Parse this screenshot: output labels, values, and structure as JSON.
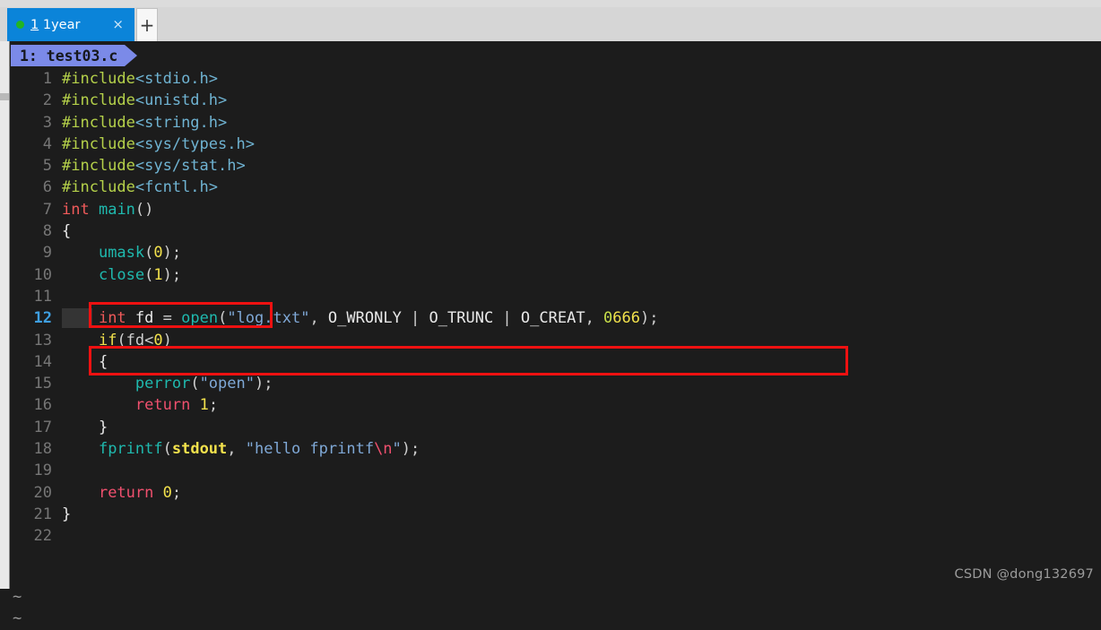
{
  "tabbar": {
    "tab": {
      "index_label": "1",
      "title": " 1year",
      "close_label": "×",
      "dot_color": "#22b522",
      "active_color": "#0b84d9"
    },
    "new_tab_label": "+"
  },
  "editor": {
    "filetab": {
      "label": "1: test03.c",
      "background": "#7b8ae8"
    },
    "current_line": 12,
    "tilde_markers": [
      "~",
      "~"
    ],
    "lines": [
      {
        "n": "1",
        "tokens": [
          {
            "t": "#include",
            "c": "t-pre"
          },
          {
            "t": "<stdio.h>",
            "c": "t-hdr"
          }
        ]
      },
      {
        "n": "2",
        "tokens": [
          {
            "t": "#include",
            "c": "t-pre"
          },
          {
            "t": "<unistd.h>",
            "c": "t-hdr"
          }
        ]
      },
      {
        "n": "3",
        "tokens": [
          {
            "t": "#include",
            "c": "t-pre"
          },
          {
            "t": "<string.h>",
            "c": "t-hdr"
          }
        ]
      },
      {
        "n": "4",
        "tokens": [
          {
            "t": "#include",
            "c": "t-pre"
          },
          {
            "t": "<sys/types.h>",
            "c": "t-hdr"
          }
        ]
      },
      {
        "n": "5",
        "tokens": [
          {
            "t": "#include",
            "c": "t-pre"
          },
          {
            "t": "<sys/stat.h>",
            "c": "t-hdr"
          }
        ]
      },
      {
        "n": "6",
        "tokens": [
          {
            "t": "#include",
            "c": "t-pre"
          },
          {
            "t": "<fcntl.h>",
            "c": "t-hdr"
          }
        ]
      },
      {
        "n": "7",
        "tokens": [
          {
            "t": "int",
            "c": "t-type"
          },
          {
            "t": " ",
            "c": "t-plain"
          },
          {
            "t": "main",
            "c": "t-fn"
          },
          {
            "t": "()",
            "c": "t-punct"
          }
        ]
      },
      {
        "n": "8",
        "tokens": [
          {
            "t": "{",
            "c": "t-brace"
          }
        ]
      },
      {
        "n": "9",
        "tokens": [
          {
            "t": "    ",
            "c": "t-plain"
          },
          {
            "t": "umask",
            "c": "t-fn"
          },
          {
            "t": "(",
            "c": "t-punct"
          },
          {
            "t": "0",
            "c": "t-num"
          },
          {
            "t": ");",
            "c": "t-punct"
          }
        ]
      },
      {
        "n": "10",
        "tokens": [
          {
            "t": "    ",
            "c": "t-plain"
          },
          {
            "t": "close",
            "c": "t-fn"
          },
          {
            "t": "(",
            "c": "t-punct"
          },
          {
            "t": "1",
            "c": "t-num"
          },
          {
            "t": ");",
            "c": "t-punct"
          }
        ]
      },
      {
        "n": "11",
        "tokens": []
      },
      {
        "n": "12",
        "tokens": [
          {
            "t": "    ",
            "c": "t-plain"
          },
          {
            "t": "int",
            "c": "t-type"
          },
          {
            "t": " fd ",
            "c": "t-ident"
          },
          {
            "t": "= ",
            "c": "t-punct"
          },
          {
            "t": "open",
            "c": "t-fn"
          },
          {
            "t": "(",
            "c": "t-punct"
          },
          {
            "t": "\"log.txt\"",
            "c": "t-str"
          },
          {
            "t": ", ",
            "c": "t-punct"
          },
          {
            "t": "O_WRONLY",
            "c": "t-macro"
          },
          {
            "t": " | ",
            "c": "t-punct"
          },
          {
            "t": "O_TRUNC",
            "c": "t-macro"
          },
          {
            "t": " | ",
            "c": "t-punct"
          },
          {
            "t": "O_CREAT",
            "c": "t-macro"
          },
          {
            "t": ", ",
            "c": "t-punct"
          },
          {
            "t": "0",
            "c": "t-numoct"
          },
          {
            "t": "666",
            "c": "t-num"
          },
          {
            "t": ");",
            "c": "t-punct"
          }
        ]
      },
      {
        "n": "13",
        "tokens": [
          {
            "t": "    ",
            "c": "t-plain"
          },
          {
            "t": "if",
            "c": "t-kw"
          },
          {
            "t": "(fd<",
            "c": "t-punct"
          },
          {
            "t": "0",
            "c": "t-num"
          },
          {
            "t": ")",
            "c": "t-punct"
          }
        ]
      },
      {
        "n": "14",
        "tokens": [
          {
            "t": "    ",
            "c": "t-plain"
          },
          {
            "t": "{",
            "c": "t-brace"
          }
        ]
      },
      {
        "n": "15",
        "tokens": [
          {
            "t": "        ",
            "c": "t-plain"
          },
          {
            "t": "perror",
            "c": "t-fn"
          },
          {
            "t": "(",
            "c": "t-punct"
          },
          {
            "t": "\"open\"",
            "c": "t-str"
          },
          {
            "t": ");",
            "c": "t-punct"
          }
        ]
      },
      {
        "n": "16",
        "tokens": [
          {
            "t": "        ",
            "c": "t-plain"
          },
          {
            "t": "return",
            "c": "t-ret"
          },
          {
            "t": " ",
            "c": "t-plain"
          },
          {
            "t": "1",
            "c": "t-num"
          },
          {
            "t": ";",
            "c": "t-punct"
          }
        ]
      },
      {
        "n": "17",
        "tokens": [
          {
            "t": "    ",
            "c": "t-plain"
          },
          {
            "t": "}",
            "c": "t-brace"
          }
        ]
      },
      {
        "n": "18",
        "tokens": [
          {
            "t": "    ",
            "c": "t-plain"
          },
          {
            "t": "fprintf",
            "c": "t-fn"
          },
          {
            "t": "(",
            "c": "t-punct"
          },
          {
            "t": "stdout",
            "c": "t-std"
          },
          {
            "t": ", ",
            "c": "t-punct"
          },
          {
            "t": "\"hello fprintf",
            "c": "t-str"
          },
          {
            "t": "\\n",
            "c": "t-esc"
          },
          {
            "t": "\"",
            "c": "t-str"
          },
          {
            "t": ");",
            "c": "t-punct"
          }
        ]
      },
      {
        "n": "19",
        "tokens": []
      },
      {
        "n": "20",
        "tokens": [
          {
            "t": "    ",
            "c": "t-plain"
          },
          {
            "t": "return",
            "c": "t-ret"
          },
          {
            "t": " ",
            "c": "t-plain"
          },
          {
            "t": "0",
            "c": "t-num"
          },
          {
            "t": ";",
            "c": "t-punct"
          }
        ]
      },
      {
        "n": "21",
        "tokens": [
          {
            "t": "}",
            "c": "t-brace"
          }
        ]
      },
      {
        "n": "22",
        "tokens": []
      }
    ]
  },
  "annotations": [
    {
      "name": "close-call",
      "color": "#ee1111"
    },
    {
      "name": "open-call",
      "color": "#ee1111"
    }
  ],
  "watermark": {
    "text": "CSDN @dong132697"
  }
}
